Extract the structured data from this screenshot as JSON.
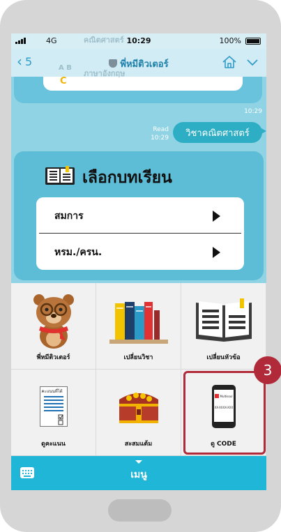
{
  "status_bar": {
    "carrier": "4G",
    "time": "10:29",
    "battery": "100%"
  },
  "nav": {
    "back_count": "5",
    "title": "พี่หมีติวเตอร์"
  },
  "chat": {
    "ghost_line_1": "คณิตศาสตร์",
    "ghost_abc": "A B",
    "ghost_line_2": "ภาษาอังกฤษ",
    "c_letter": "C",
    "time_1": "10:29",
    "read_label": "Read",
    "read_time": "10:29",
    "bubble_text": "วิชาคณิตศาสตร์"
  },
  "lesson_card": {
    "title": "เลือกบทเรียน",
    "options": [
      {
        "label": "สมการ"
      },
      {
        "label": "หรม./ครน."
      }
    ]
  },
  "rich_menu": {
    "tiles": [
      {
        "label": "พี่หมีติวเตอร์",
        "icon": "bear-tutor-icon"
      },
      {
        "label": "เปลี่ยนวิชา",
        "icon": "books-icon"
      },
      {
        "label": "เปลี่ยนหัวข้อ",
        "icon": "open-book-icon"
      },
      {
        "label": "ดูคะแนน",
        "icon": "score-sheet-icon",
        "sheet_title": "คะแนนที่ได้"
      },
      {
        "label": "สะสมแต้ม",
        "icon": "treasure-chest-icon"
      },
      {
        "label": "ดู CODE",
        "icon": "phone-code-icon",
        "brand": "Multisoul",
        "code": "XX-XXXX-XXX"
      }
    ],
    "step_badge": "3",
    "highlight_color": "#b02a3a"
  },
  "menu_bar": {
    "label": "เมนู"
  },
  "colors": {
    "accent": "#1fb6d8",
    "chat_bg": "#8fd3e4",
    "card": "#5dbcd6"
  }
}
